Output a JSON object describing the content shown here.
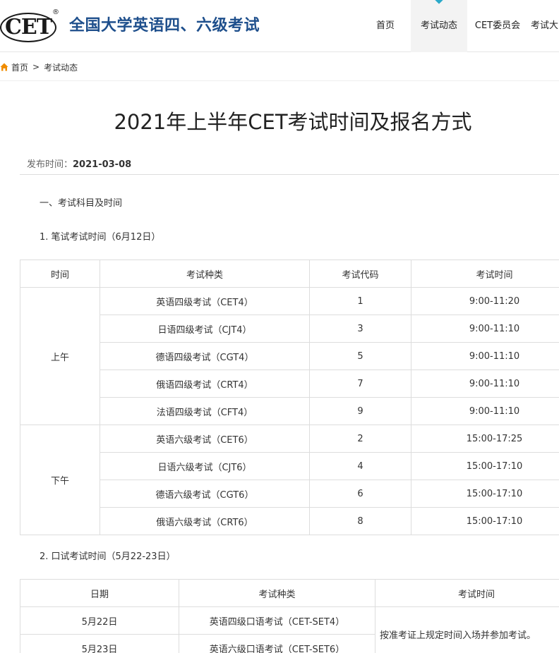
{
  "header": {
    "logo_text": "CET",
    "logo_reg": "®",
    "site_title": "全国大学英语四、六级考试",
    "nav": [
      "首页",
      "考试动态",
      "CET委员会",
      "考试大"
    ]
  },
  "breadcrumb": {
    "home": "首页",
    "separator": ">",
    "current": "考试动态"
  },
  "article": {
    "title": "2021年上半年CET考试时间及报名方式",
    "publish_label": "发布时间：",
    "publish_date": "2021-03-08",
    "section1": "一、考试科目及时间",
    "sub1": "1. 笔试考试时间（6月12日）",
    "sub2": "2. 口试考试时间（5月22-23日）"
  },
  "written_table": {
    "headers": [
      "时间",
      "考试种类",
      "考试代码",
      "考试时间"
    ],
    "morning_label": "上午",
    "afternoon_label": "下午",
    "rows": [
      {
        "type": "英语四级考试（CET4）",
        "code": "1",
        "time": "9:00-11:20"
      },
      {
        "type": "日语四级考试（CJT4）",
        "code": "3",
        "time": "9:00-11:10"
      },
      {
        "type": "德语四级考试（CGT4）",
        "code": "5",
        "time": "9:00-11:10"
      },
      {
        "type": "俄语四级考试（CRT4）",
        "code": "7",
        "time": "9:00-11:10"
      },
      {
        "type": "法语四级考试（CFT4）",
        "code": "9",
        "time": "9:00-11:10"
      },
      {
        "type": "英语六级考试（CET6）",
        "code": "2",
        "time": "15:00-17:25"
      },
      {
        "type": "日语六级考试（CJT6）",
        "code": "4",
        "time": "15:00-17:10"
      },
      {
        "type": "德语六级考试（CGT6）",
        "code": "6",
        "time": "15:00-17:10"
      },
      {
        "type": "俄语六级考试（CRT6）",
        "code": "8",
        "time": "15:00-17:10"
      }
    ]
  },
  "oral_table": {
    "headers": [
      "日期",
      "考试种类",
      "考试时间"
    ],
    "rows": [
      {
        "date": "5月22日",
        "type": "英语四级口语考试（CET-SET4）"
      },
      {
        "date": "5月23日",
        "type": "英语六级口语考试（CET-SET6）"
      }
    ],
    "note": "按准考证上规定时间入场并参加考试。"
  },
  "colors": {
    "title_blue": "#1e4f8c",
    "home_icon": "#f08c00",
    "nav_marker": "#2aa9c9"
  },
  "icons": {
    "home": "home-icon"
  }
}
